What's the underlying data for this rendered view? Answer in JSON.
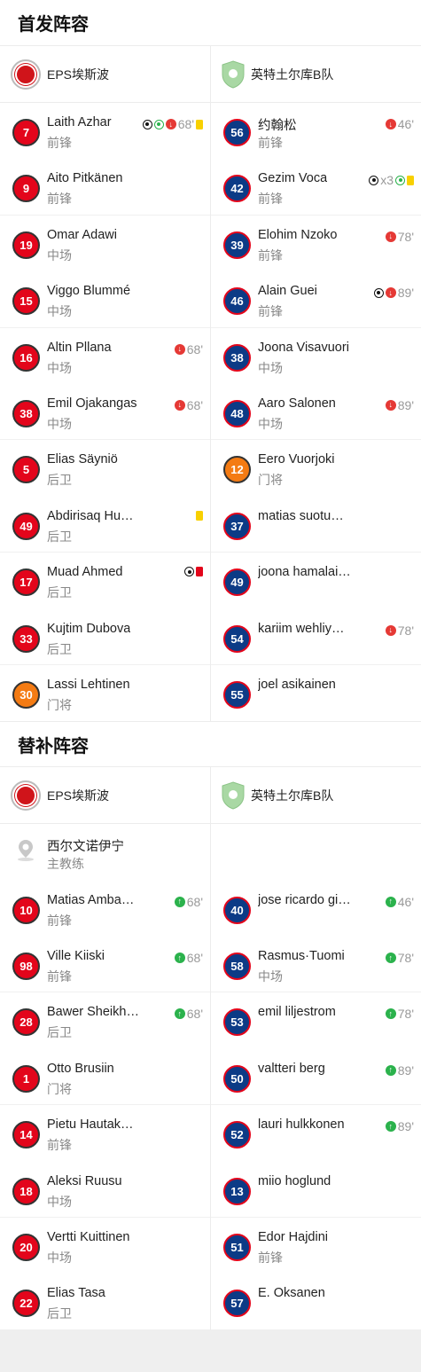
{
  "starting_title": "首发阵容",
  "subs_title": "替补阵容",
  "home_team": "EPS埃斯波",
  "away_team": "英特土尔库B队",
  "starting": {
    "home": [
      {
        "num": "7",
        "name": "Laith Azhar",
        "pos": "前锋",
        "color": "red",
        "events": [
          {
            "t": "ball"
          },
          {
            "t": "gball"
          },
          {
            "t": "out"
          },
          {
            "t": "text",
            "v": "68'"
          },
          {
            "t": "yellow"
          }
        ]
      },
      {
        "num": "9",
        "name": "Aito Pitkänen",
        "pos": "前锋",
        "color": "red",
        "events": []
      },
      {
        "num": "19",
        "name": "Omar Adawi",
        "pos": "中场",
        "color": "red",
        "events": []
      },
      {
        "num": "15",
        "name": "Viggo Blummé",
        "pos": "中场",
        "color": "red",
        "events": []
      },
      {
        "num": "16",
        "name": "Altin Pllana",
        "pos": "中场",
        "color": "red",
        "events": [
          {
            "t": "out"
          },
          {
            "t": "text",
            "v": "68'"
          }
        ]
      },
      {
        "num": "38",
        "name": "Emil Ojakangas",
        "pos": "中场",
        "color": "red",
        "events": [
          {
            "t": "out"
          },
          {
            "t": "text",
            "v": "68'"
          }
        ]
      },
      {
        "num": "5",
        "name": "Elias Säyniö",
        "pos": "后卫",
        "color": "red",
        "events": []
      },
      {
        "num": "49",
        "name": "Abdirisaq Hu…",
        "pos": "后卫",
        "color": "red",
        "events": [
          {
            "t": "yellow"
          }
        ]
      },
      {
        "num": "17",
        "name": "Muad Ahmed",
        "pos": "后卫",
        "color": "red",
        "events": [
          {
            "t": "ball"
          },
          {
            "t": "red"
          }
        ]
      },
      {
        "num": "33",
        "name": "Kujtim Dubova",
        "pos": "后卫",
        "color": "red",
        "events": []
      },
      {
        "num": "30",
        "name": "Lassi Lehtinen",
        "pos": "门将",
        "color": "orange",
        "events": []
      }
    ],
    "away": [
      {
        "num": "56",
        "name": "约翰松",
        "pos": "前锋",
        "color": "blue",
        "events": [
          {
            "t": "out"
          },
          {
            "t": "text",
            "v": "46'"
          }
        ]
      },
      {
        "num": "42",
        "name": "Gezim Voca",
        "pos": "前锋",
        "color": "blue",
        "events": [
          {
            "t": "ball"
          },
          {
            "t": "text",
            "v": "x3"
          },
          {
            "t": "gball"
          },
          {
            "t": "yellow"
          }
        ]
      },
      {
        "num": "39",
        "name": "Elohim Nzoko",
        "pos": "前锋",
        "color": "blue",
        "events": [
          {
            "t": "out"
          },
          {
            "t": "text",
            "v": "78'"
          }
        ]
      },
      {
        "num": "46",
        "name": "Alain Guei",
        "pos": "前锋",
        "color": "blue",
        "events": [
          {
            "t": "ball"
          },
          {
            "t": "out"
          },
          {
            "t": "text",
            "v": "89'"
          }
        ]
      },
      {
        "num": "38",
        "name": "Joona Visavuori",
        "pos": "中场",
        "color": "blue",
        "events": []
      },
      {
        "num": "48",
        "name": "Aaro Salonen",
        "pos": "中场",
        "color": "blue",
        "events": [
          {
            "t": "out"
          },
          {
            "t": "text",
            "v": "89'"
          }
        ]
      },
      {
        "num": "12",
        "name": "Eero Vuorjoki",
        "pos": "门将",
        "color": "orange",
        "events": []
      },
      {
        "num": "37",
        "name": "matias suotu…",
        "pos": "",
        "color": "blue",
        "events": []
      },
      {
        "num": "49",
        "name": "joona hamalai…",
        "pos": "",
        "color": "blue",
        "events": []
      },
      {
        "num": "54",
        "name": "kariim wehliy…",
        "pos": "",
        "color": "blue",
        "events": [
          {
            "t": "out"
          },
          {
            "t": "text",
            "v": "78'"
          }
        ]
      },
      {
        "num": "55",
        "name": "joel asikainen",
        "pos": "",
        "color": "blue",
        "events": []
      }
    ]
  },
  "coach": {
    "name": "西尔文诺伊宁",
    "role": "主教练"
  },
  "subs": {
    "home": [
      {
        "num": "10",
        "name": "Matias Amba…",
        "pos": "前锋",
        "color": "red",
        "events": [
          {
            "t": "in"
          },
          {
            "t": "text",
            "v": "68'"
          }
        ]
      },
      {
        "num": "98",
        "name": "Ville Kiiski",
        "pos": "前锋",
        "color": "red",
        "events": [
          {
            "t": "in"
          },
          {
            "t": "text",
            "v": "68'"
          }
        ]
      },
      {
        "num": "28",
        "name": "Bawer Sheikh…",
        "pos": "后卫",
        "color": "red",
        "events": [
          {
            "t": "in"
          },
          {
            "t": "text",
            "v": "68'"
          }
        ]
      },
      {
        "num": "1",
        "name": "Otto Brusiin",
        "pos": "门将",
        "color": "red",
        "events": []
      },
      {
        "num": "14",
        "name": "Pietu Hautak…",
        "pos": "前锋",
        "color": "red",
        "events": []
      },
      {
        "num": "18",
        "name": "Aleksi Ruusu",
        "pos": "中场",
        "color": "red",
        "events": []
      },
      {
        "num": "20",
        "name": "Vertti Kuittinen",
        "pos": "中场",
        "color": "red",
        "events": []
      },
      {
        "num": "22",
        "name": "Elias Tasa",
        "pos": "后卫",
        "color": "red",
        "events": []
      }
    ],
    "away": [
      {
        "num": "40",
        "name": "jose ricardo gi…",
        "pos": "",
        "color": "blue",
        "events": [
          {
            "t": "in"
          },
          {
            "t": "text",
            "v": "46'"
          }
        ]
      },
      {
        "num": "58",
        "name": "Rasmus·Tuomi",
        "pos": "中场",
        "color": "blue",
        "events": [
          {
            "t": "in"
          },
          {
            "t": "text",
            "v": "78'"
          }
        ]
      },
      {
        "num": "53",
        "name": "emil liljestrom",
        "pos": "",
        "color": "blue",
        "events": [
          {
            "t": "in"
          },
          {
            "t": "text",
            "v": "78'"
          }
        ]
      },
      {
        "num": "50",
        "name": "valtteri berg",
        "pos": "",
        "color": "blue",
        "events": [
          {
            "t": "in"
          },
          {
            "t": "text",
            "v": "89'"
          }
        ]
      },
      {
        "num": "52",
        "name": "lauri hulkkonen",
        "pos": "",
        "color": "blue",
        "events": [
          {
            "t": "in"
          },
          {
            "t": "text",
            "v": "89'"
          }
        ]
      },
      {
        "num": "13",
        "name": "miio hoglund",
        "pos": "",
        "color": "blue",
        "events": []
      },
      {
        "num": "51",
        "name": "Edor Hajdini",
        "pos": "前锋",
        "color": "blue",
        "events": []
      },
      {
        "num": "57",
        "name": "E. Oksanen",
        "pos": "",
        "color": "blue",
        "events": []
      }
    ]
  }
}
